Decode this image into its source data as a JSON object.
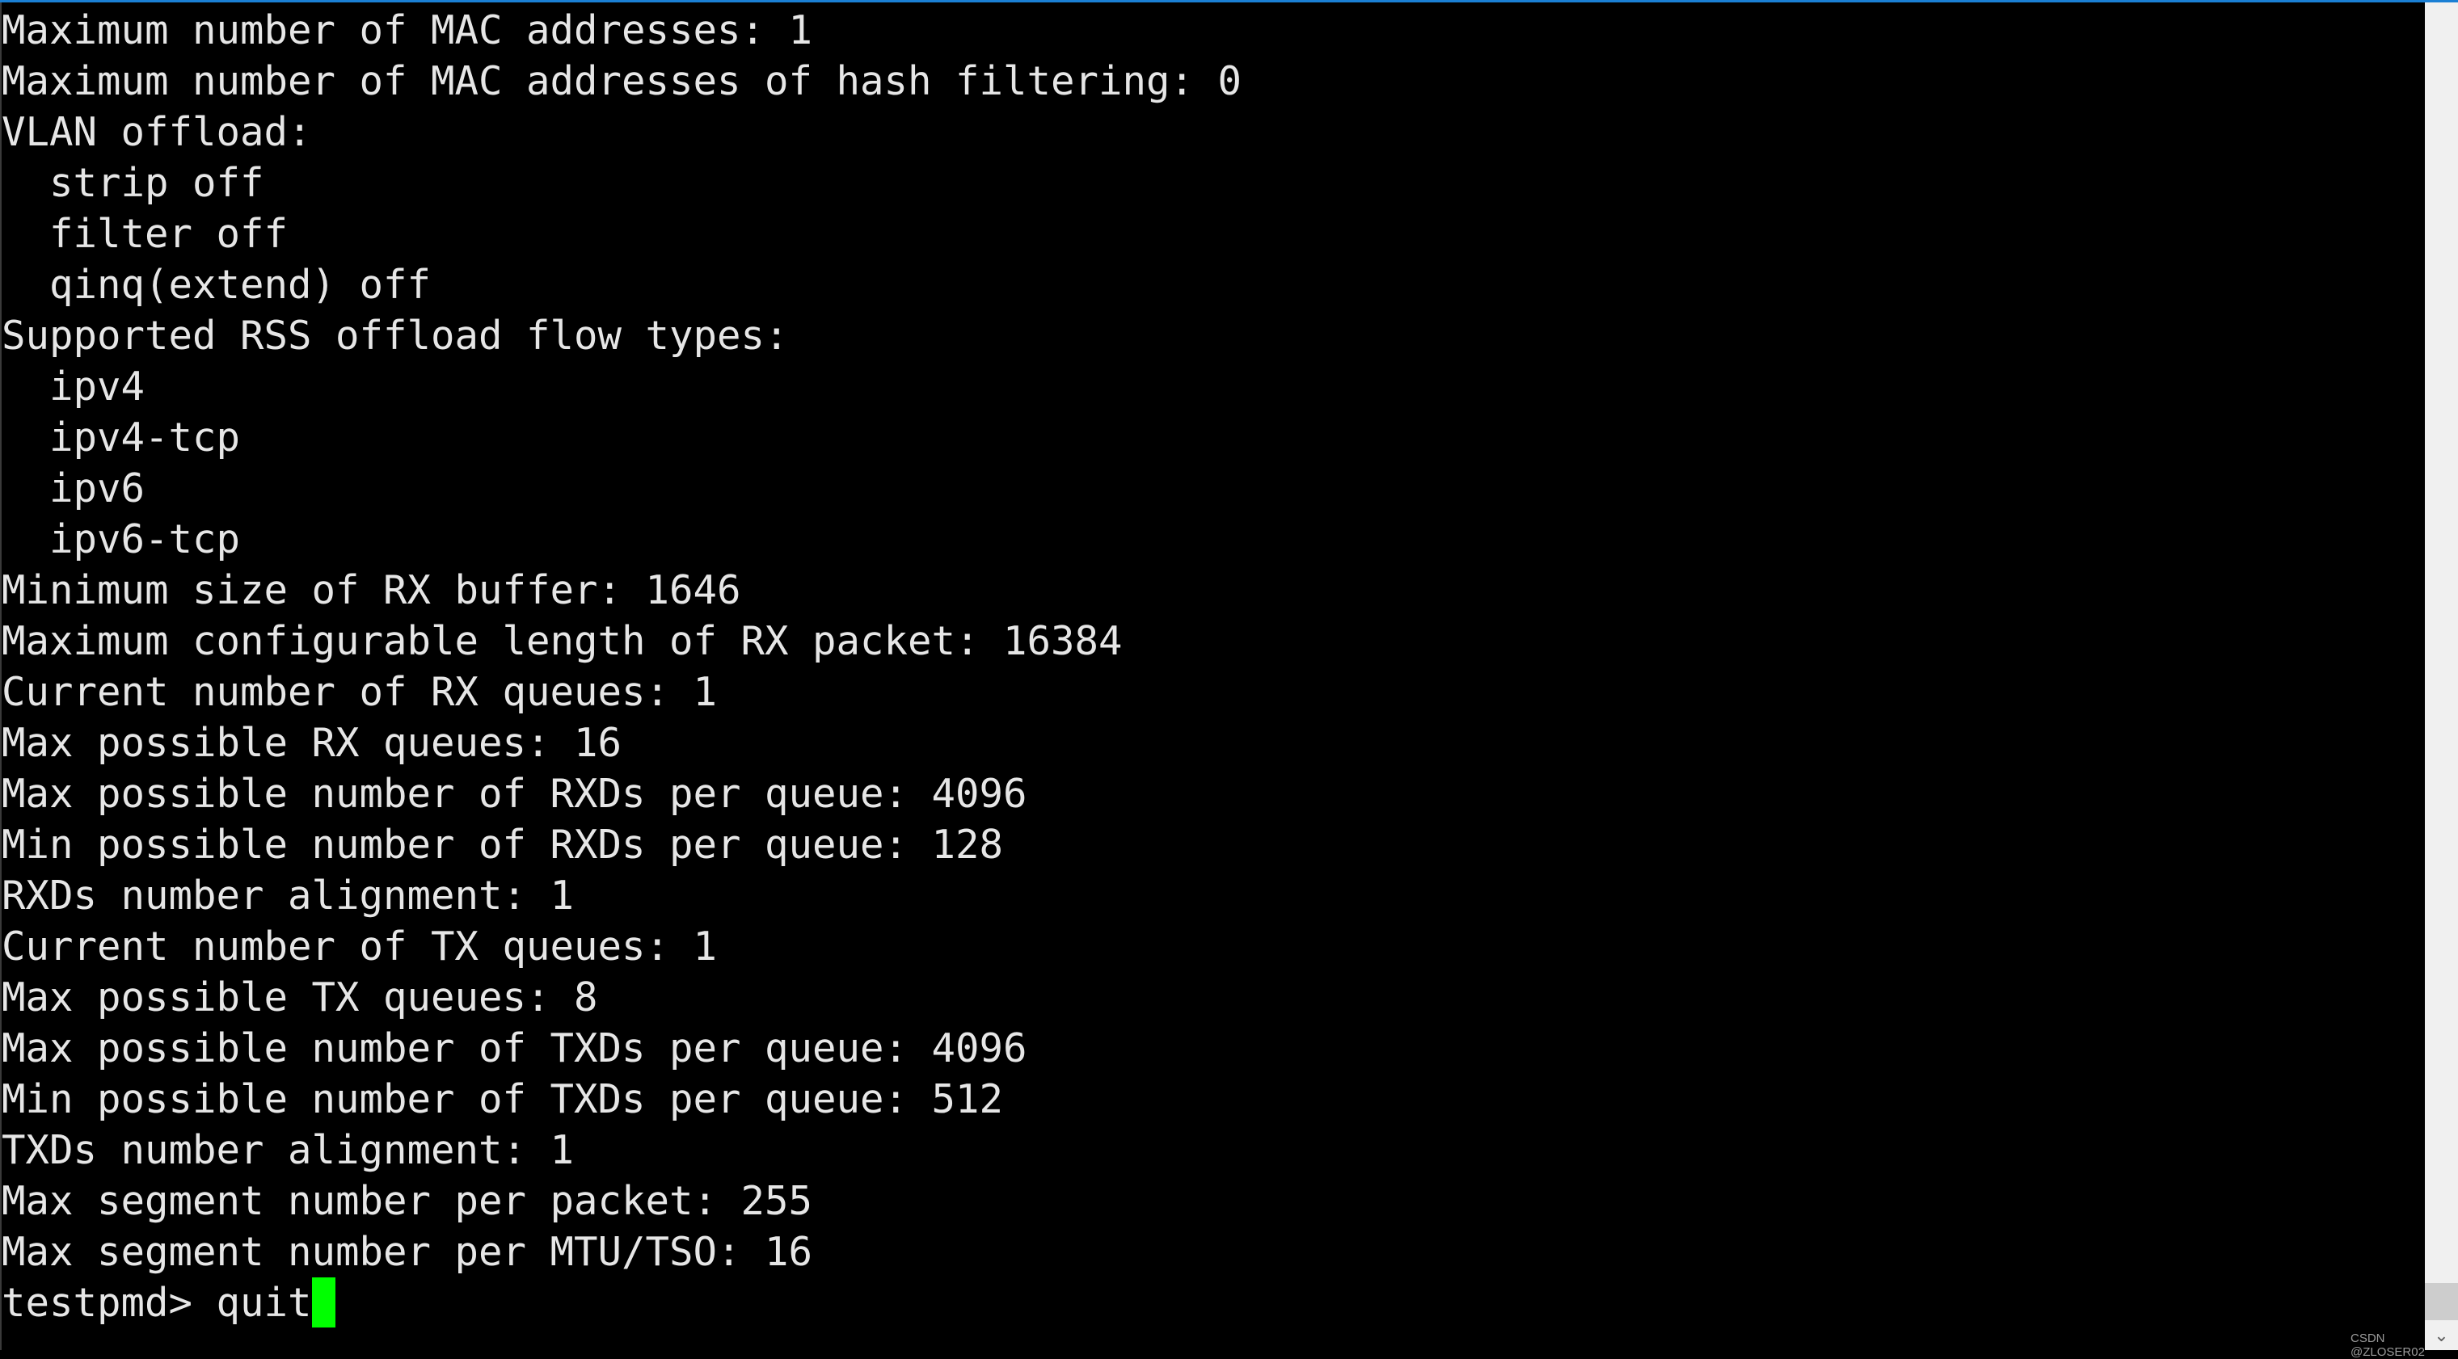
{
  "terminal": {
    "lines": [
      "Maximum number of MAC addresses: 1",
      "Maximum number of MAC addresses of hash filtering: 0",
      "VLAN offload:",
      "  strip off",
      "  filter off",
      "  qinq(extend) off",
      "Supported RSS offload flow types:",
      "  ipv4",
      "  ipv4-tcp",
      "  ipv6",
      "  ipv6-tcp",
      "Minimum size of RX buffer: 1646",
      "Maximum configurable length of RX packet: 16384",
      "Current number of RX queues: 1",
      "Max possible RX queues: 16",
      "Max possible number of RXDs per queue: 4096",
      "Min possible number of RXDs per queue: 128",
      "RXDs number alignment: 1",
      "Current number of TX queues: 1",
      "Max possible TX queues: 8",
      "Max possible number of TXDs per queue: 4096",
      "Min possible number of TXDs per queue: 512",
      "TXDs number alignment: 1",
      "Max segment number per packet: 255",
      "Max segment number per MTU/TSO: 16"
    ],
    "prompt": "testpmd> ",
    "command": "quit",
    "cursor_color": "#00ff00"
  },
  "scrollbar": {
    "down_arrow_icon": "chevron-down-icon"
  },
  "watermark": "CSDN @ZLOSER02"
}
